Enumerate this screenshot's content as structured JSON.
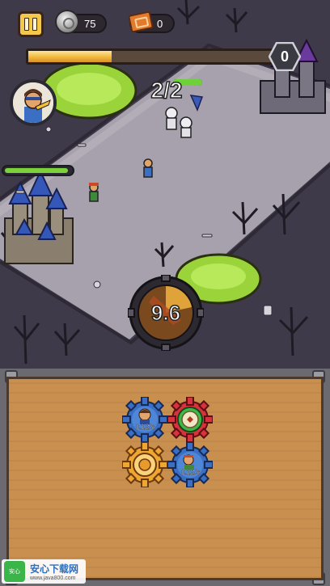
{
  "hud": {
    "coins": "75",
    "tickets": "0",
    "wave_progress": 0.34,
    "wave_number": "0"
  },
  "battle": {
    "enemy_count": "2/2",
    "hero_hp": 0.95,
    "enemy_hp": 1.0,
    "cooldown_value": "9.6"
  },
  "panel": {
    "gears": [
      {
        "kind": "hero-gear",
        "color": "#3a6fc4",
        "rate": "0.12/s"
      },
      {
        "kind": "bonus-gear",
        "color": "#d8323c",
        "rate": ""
      },
      {
        "kind": "empty-gear",
        "color": "#f0a632",
        "rate": ""
      },
      {
        "kind": "hero-gear",
        "color": "#3a6fc4",
        "rate": "0.12/s"
      }
    ]
  },
  "watermark": {
    "logo": "安心",
    "title": "安心下载网",
    "url": "www.java800.com"
  },
  "colors": {
    "toxic": "#9bd43a",
    "road": "#a09aa6",
    "grass": "#4a4354",
    "board": "#c98f4f"
  }
}
